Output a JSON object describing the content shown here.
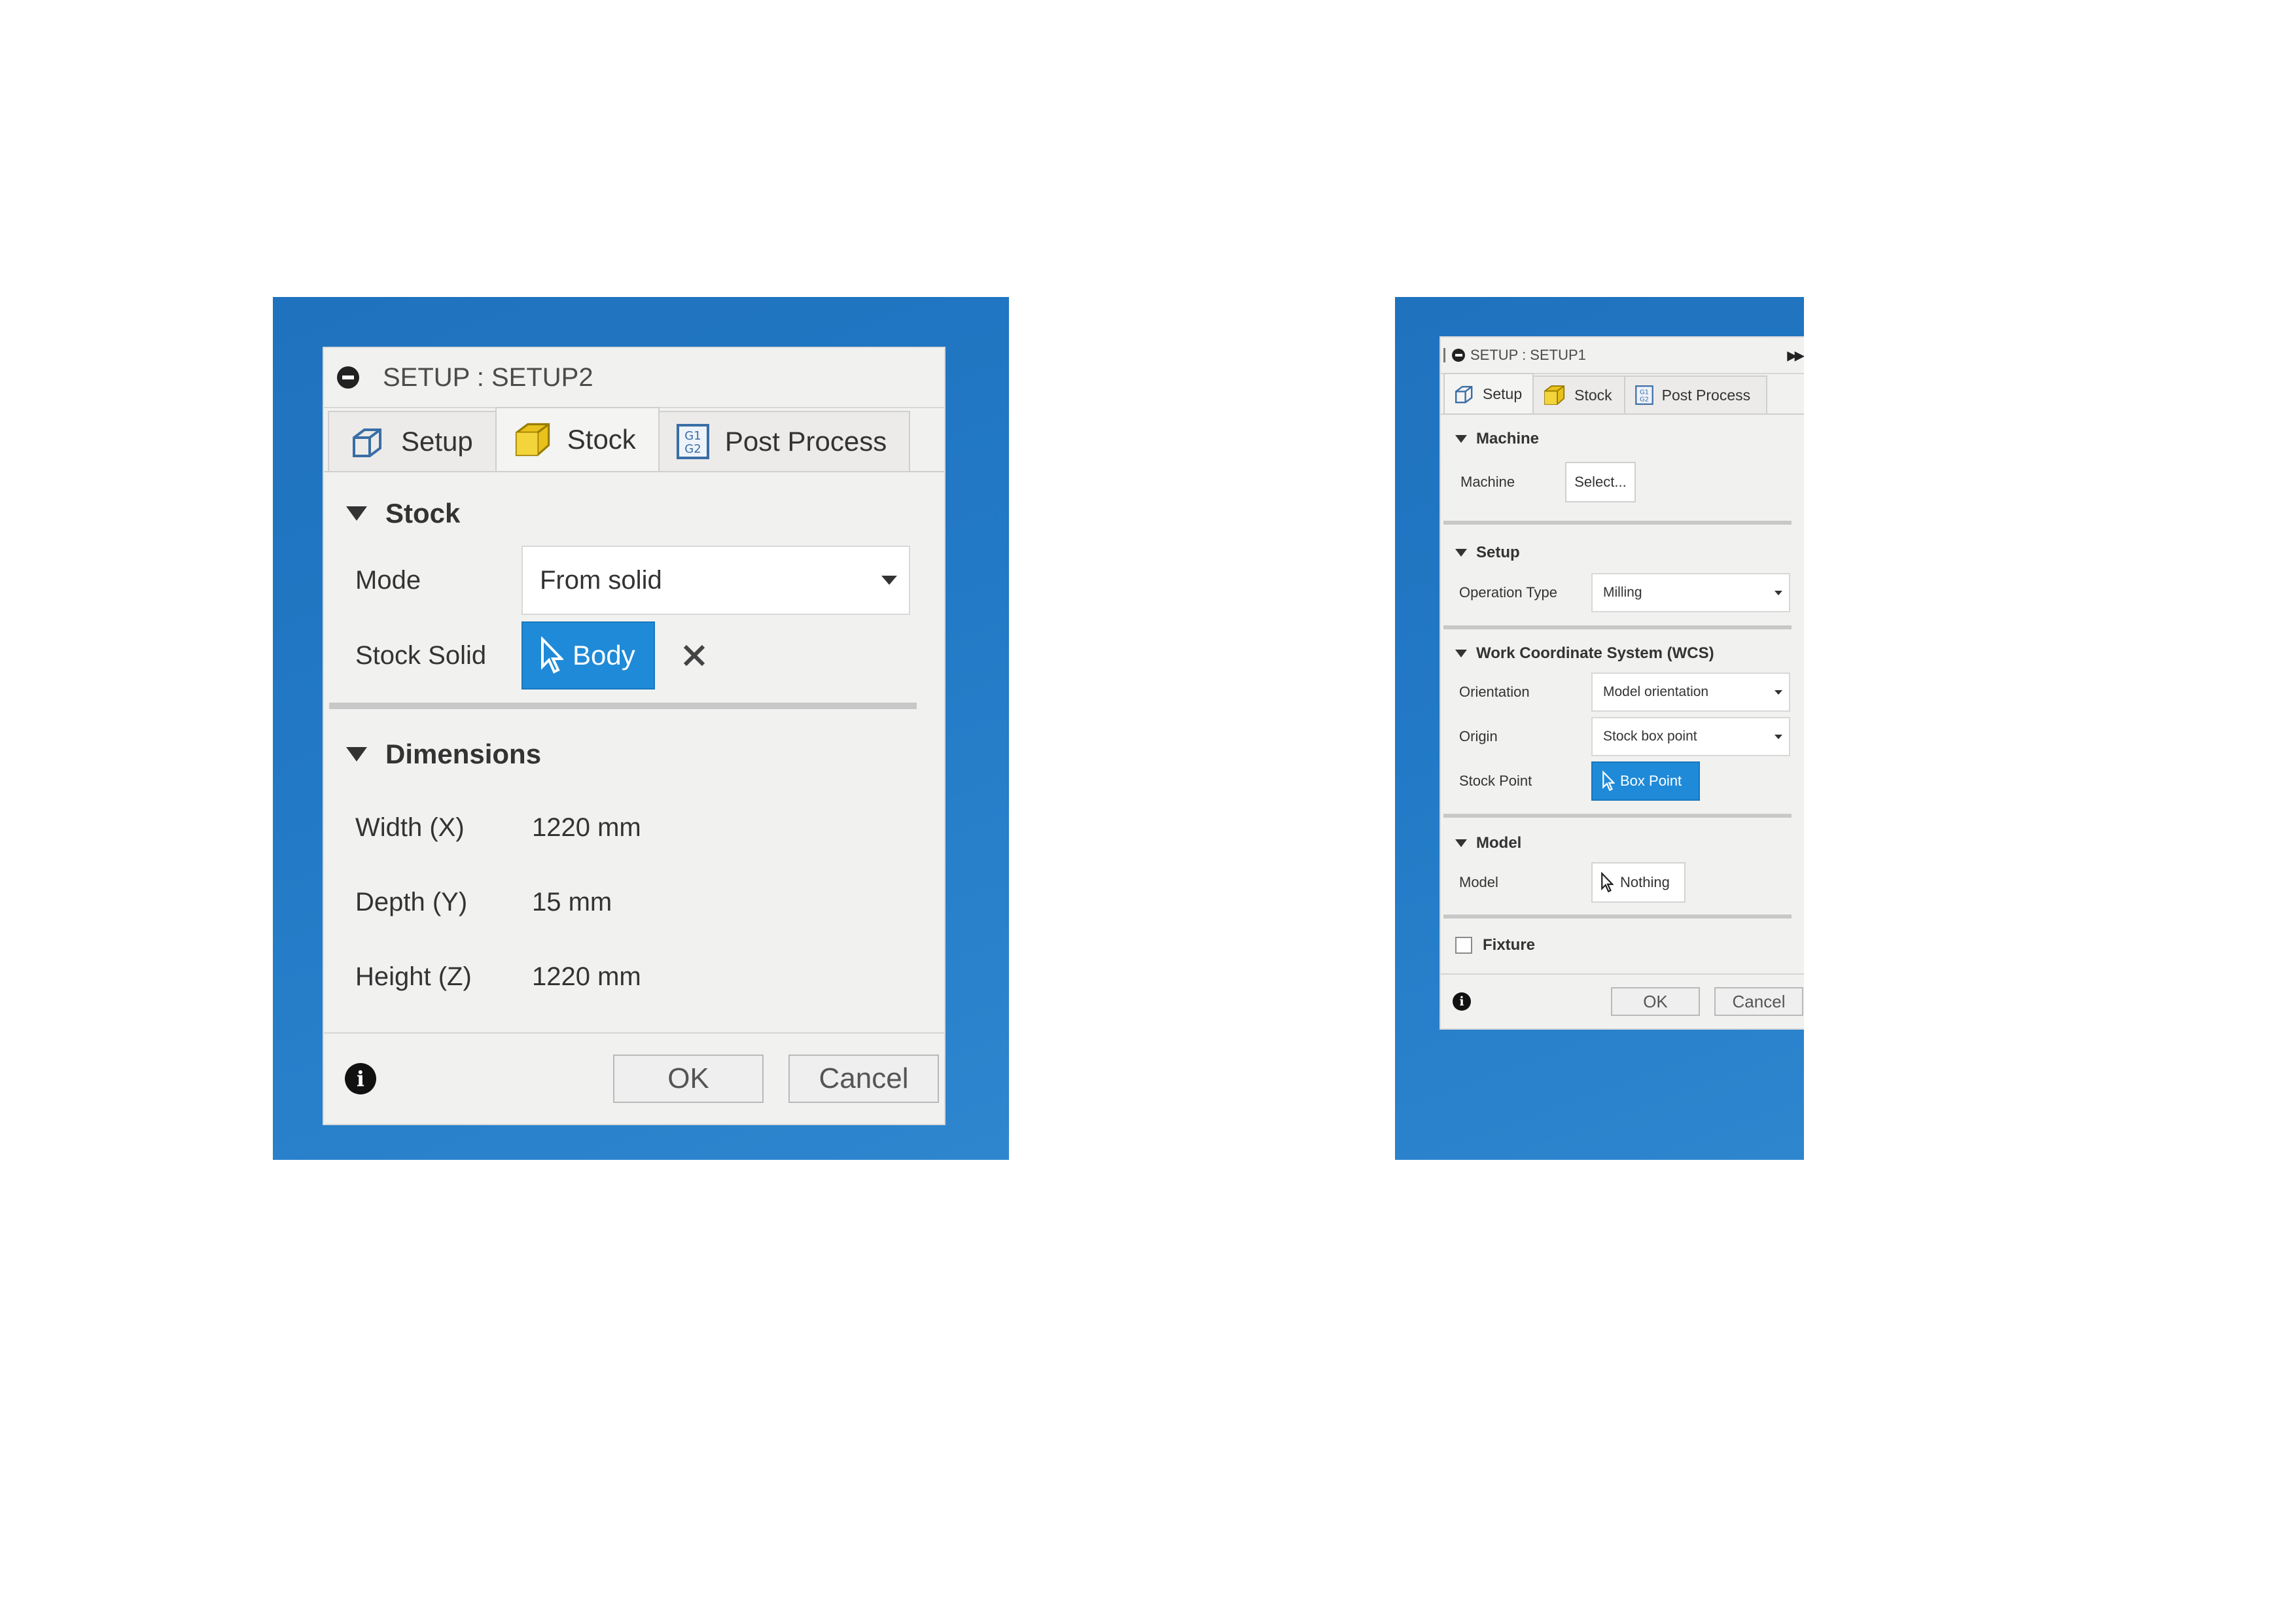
{
  "left": {
    "title": "SETUP : SETUP2",
    "tabs": [
      {
        "label": "Setup",
        "icon": "setup-cube-icon"
      },
      {
        "label": "Stock",
        "icon": "stock-box-icon"
      },
      {
        "label": "Post Process",
        "icon": "gcode-icon"
      }
    ],
    "active_tab": "Stock",
    "stock": {
      "heading": "Stock",
      "mode_label": "Mode",
      "mode_value": "From solid",
      "solid_label": "Stock Solid",
      "solid_value": "Body"
    },
    "dimensions": {
      "heading": "Dimensions",
      "rows": [
        {
          "label": "Width (X)",
          "value": "1220 mm"
        },
        {
          "label": "Depth (Y)",
          "value": "15 mm"
        },
        {
          "label": "Height (Z)",
          "value": "1220 mm"
        }
      ]
    },
    "ok": "OK",
    "cancel": "Cancel"
  },
  "right": {
    "title": "SETUP : SETUP1",
    "tabs": [
      {
        "label": "Setup",
        "icon": "setup-cube-icon"
      },
      {
        "label": "Stock",
        "icon": "stock-box-icon"
      },
      {
        "label": "Post Process",
        "icon": "gcode-icon"
      }
    ],
    "active_tab": "Setup",
    "machine": {
      "heading": "Machine",
      "label": "Machine",
      "button": "Select..."
    },
    "setup": {
      "heading": "Setup",
      "label": "Operation Type",
      "value": "Milling"
    },
    "wcs": {
      "heading": "Work Coordinate System (WCS)",
      "orientation_label": "Orientation",
      "orientation_value": "Model orientation",
      "origin_label": "Origin",
      "origin_value": "Stock box point",
      "stock_point_label": "Stock Point",
      "stock_point_value": "Box Point"
    },
    "model": {
      "heading": "Model",
      "label": "Model",
      "value": "Nothing"
    },
    "fixture": {
      "label": "Fixture",
      "checked": false
    },
    "ok": "OK",
    "cancel": "Cancel"
  },
  "colors": {
    "desktop_blue": "#2279c5",
    "selection_blue": "#1f8ad8",
    "panel_bg": "#f1f1f0"
  }
}
